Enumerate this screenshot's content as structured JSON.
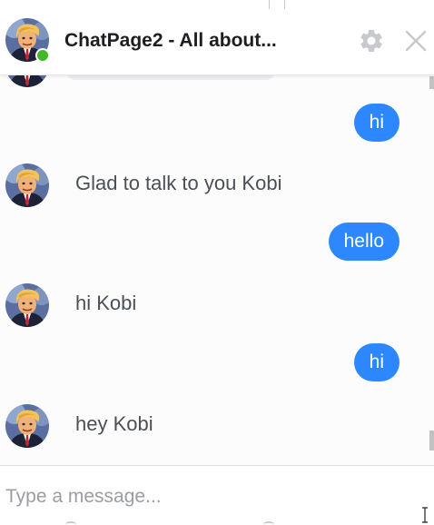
{
  "header": {
    "title": "ChatPage2 - All about...",
    "online": true,
    "settings_icon": "gear-icon",
    "close_icon": "close-icon"
  },
  "messages": [
    {
      "direction": "out",
      "text": "hi"
    },
    {
      "direction": "in",
      "text": "Glad to talk to you Kobi"
    },
    {
      "direction": "out",
      "text": "hello"
    },
    {
      "direction": "in",
      "text": "hi Kobi"
    },
    {
      "direction": "out",
      "text": "hi"
    },
    {
      "direction": "in",
      "text": "hey Kobi"
    }
  ],
  "composer": {
    "placeholder": "Type a message..."
  },
  "colors": {
    "outgoing_bubble": "#2d88ff",
    "online_dot": "#42b72a",
    "incoming_text": "#4b4f56"
  }
}
